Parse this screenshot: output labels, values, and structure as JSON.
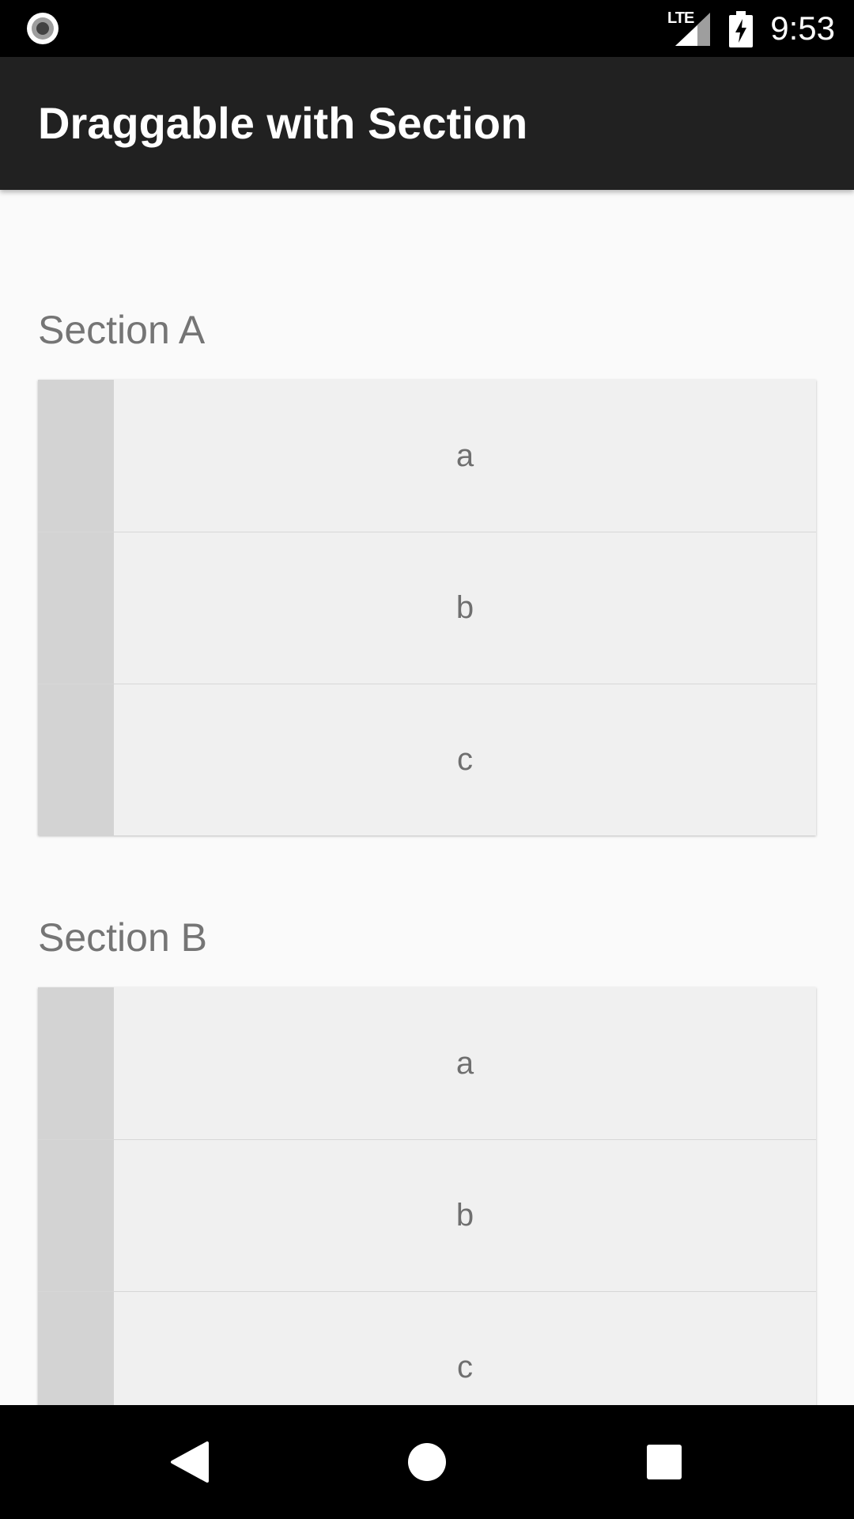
{
  "status_bar": {
    "time": "9:53",
    "network_label": "LTE",
    "icons": [
      "record-icon",
      "lte-signal-icon",
      "battery-charging-icon"
    ]
  },
  "app_bar": {
    "title": "Draggable with Section"
  },
  "sections": [
    {
      "header": "Section A",
      "items": [
        {
          "label": "a"
        },
        {
          "label": "b"
        },
        {
          "label": "c"
        }
      ]
    },
    {
      "header": "Section B",
      "items": [
        {
          "label": "a"
        },
        {
          "label": "b"
        },
        {
          "label": "c"
        }
      ]
    }
  ],
  "nav_bar": {
    "icons": [
      "back-icon",
      "home-icon",
      "recents-icon"
    ]
  },
  "colors": {
    "status_bar_bg": "#000000",
    "app_bar_bg": "#212121",
    "content_bg": "#fafafa",
    "row_bg": "#f0f0f0",
    "drag_handle": "#d3d3d3",
    "section_text": "#757575",
    "row_text": "#6f6f6f"
  }
}
